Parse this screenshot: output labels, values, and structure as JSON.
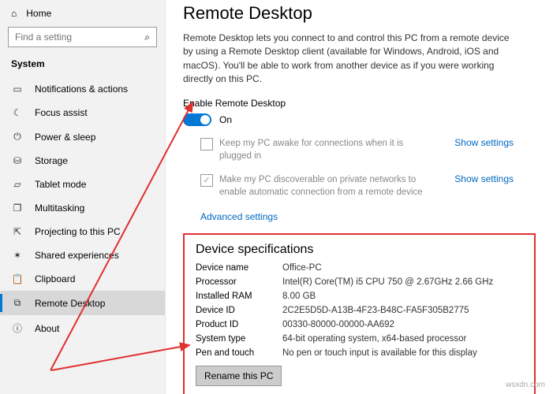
{
  "sidebar": {
    "home": "Home",
    "search_placeholder": "Find a setting",
    "category": "System",
    "items": [
      {
        "label": "Notifications & actions",
        "icon": "notifications-icon"
      },
      {
        "label": "Focus assist",
        "icon": "focus-icon"
      },
      {
        "label": "Power & sleep",
        "icon": "power-icon"
      },
      {
        "label": "Storage",
        "icon": "storage-icon"
      },
      {
        "label": "Tablet mode",
        "icon": "tablet-icon"
      },
      {
        "label": "Multitasking",
        "icon": "multitasking-icon"
      },
      {
        "label": "Projecting to this PC",
        "icon": "projecting-icon"
      },
      {
        "label": "Shared experiences",
        "icon": "shared-icon"
      },
      {
        "label": "Clipboard",
        "icon": "clipboard-icon"
      },
      {
        "label": "Remote Desktop",
        "icon": "remote-icon"
      },
      {
        "label": "About",
        "icon": "about-icon"
      }
    ]
  },
  "main": {
    "title": "Remote Desktop",
    "description": "Remote Desktop lets you connect to and control this PC from a remote device by using a Remote Desktop client (available for Windows, Android, iOS and macOS). You'll be able to work from another device as if you were working directly on this PC.",
    "enable_label": "Enable Remote Desktop",
    "toggle_state": "On",
    "check1": "Keep my PC awake for connections when it is plugged in",
    "check2": "Make my PC discoverable on private networks to enable automatic connection from a remote device",
    "show_settings": "Show settings",
    "advanced": "Advanced settings"
  },
  "spec": {
    "title": "Device specifications",
    "rows": [
      {
        "k": "Device name",
        "v": "Office-PC"
      },
      {
        "k": "Processor",
        "v": "Intel(R) Core(TM) i5 CPU      750  @ 2.67GHz  2.66 GHz"
      },
      {
        "k": "Installed RAM",
        "v": "8.00 GB"
      },
      {
        "k": "Device ID",
        "v": "2C2E5D5D-A13B-4F23-B48C-FA5F305B2775"
      },
      {
        "k": "Product ID",
        "v": "00330-80000-00000-AA692"
      },
      {
        "k": "System type",
        "v": "64-bit operating system, x64-based processor"
      },
      {
        "k": "Pen and touch",
        "v": "No pen or touch input is available for this display"
      }
    ],
    "rename": "Rename this PC"
  },
  "watermark": "wsxdn.com"
}
